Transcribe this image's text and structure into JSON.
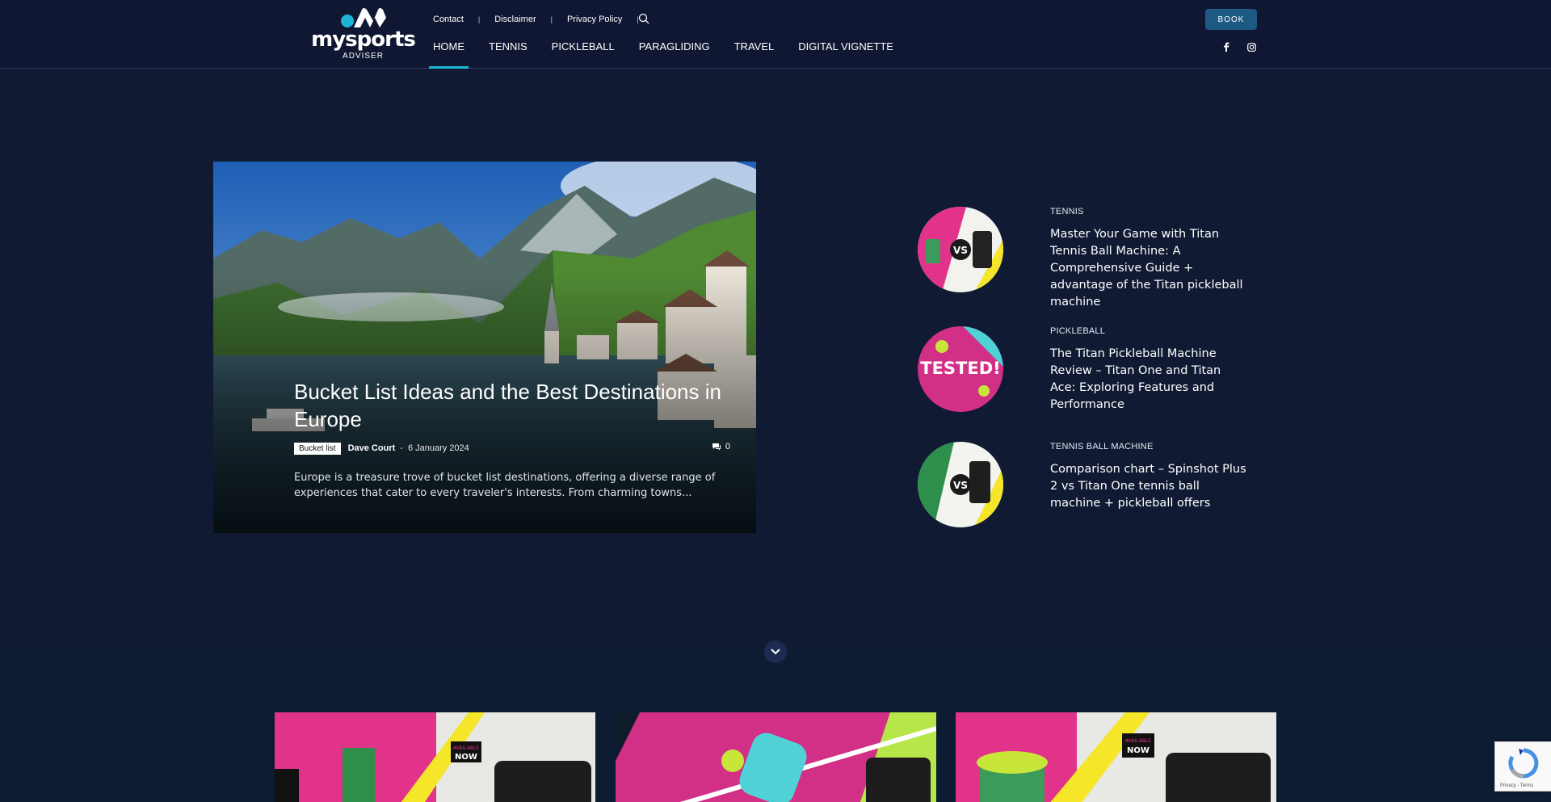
{
  "brand": {
    "name": "mysports",
    "sub": "ADVISER"
  },
  "topnav": {
    "contact": "Contact",
    "disclaimer": "Disclaimer",
    "privacy": "Privacy Policy",
    "separator": "|"
  },
  "mainnav": [
    "HOME",
    "TENNIS",
    "PICKLEBALL",
    "PARAGLIDING",
    "TRAVEL",
    "DIGITAL VIGNETTE"
  ],
  "book_label": "BOOK",
  "hero": {
    "title": "Bucket List Ideas and the Best Destinations in Europe",
    "category": "Bucket list",
    "author": "Dave Court",
    "dash": "-",
    "date": "6 January 2024",
    "comments": "0",
    "excerpt": "Europe is a treasure trove of bucket list destinations, offering a diverse range of experiences that cater to every traveler's interests. From charming towns..."
  },
  "side_posts": [
    {
      "category": "TENNIS",
      "title": "Master Your Game with Titan Tennis Ball Machine: A Comprehensive Guide + advantage of the Titan pickleball machine"
    },
    {
      "category": "PICKLEBALL",
      "title": "The Titan Pickleball Machine Review – Titan One and Titan Ace: Exploring Features and Performance"
    },
    {
      "category": "TENNIS BALL MACHINE",
      "title": "Comparison chart – Spinshot Plus 2 vs Titan One tennis ball machine + pickleball offers"
    }
  ],
  "thumb_text": {
    "tested": "TESTED!",
    "vs": "VS"
  },
  "card_text": {
    "available": "AVAILABLE",
    "now": "NOW"
  },
  "recaptcha_note": "Privacy - Terms",
  "colors": {
    "background": "#101a33",
    "accent": "#1fb6d6",
    "book_button": "#1c5a83"
  },
  "icons": [
    "search-icon",
    "facebook-icon",
    "instagram-icon",
    "comment-icon",
    "chevron-down-icon"
  ]
}
